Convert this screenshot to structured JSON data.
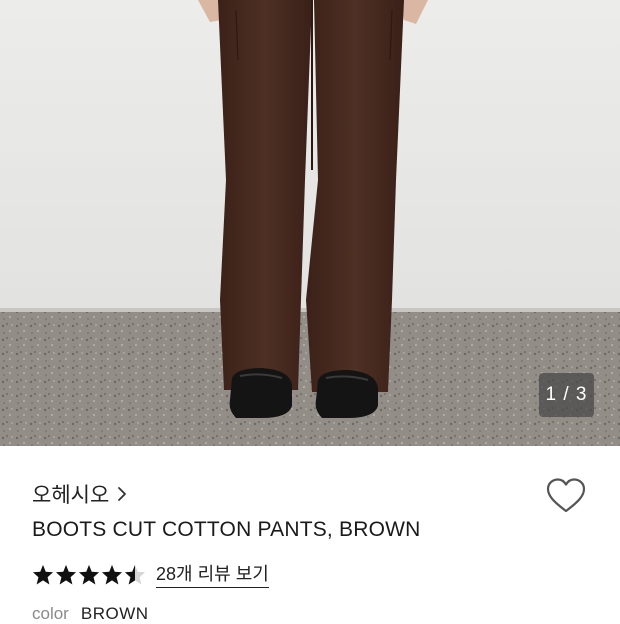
{
  "gallery": {
    "counter": "1 / 3"
  },
  "product": {
    "brand": "오헤시오",
    "title": "BOOTS CUT COTTON PANTS, BROWN",
    "rating": 4.5,
    "review_link": "28개 리뷰 보기",
    "color_label": "color",
    "color_value": "BROWN"
  },
  "icons": {
    "brand_chevron": "chevron-right-icon",
    "wishlist": "heart-outline-icon",
    "rating": "star-icon"
  },
  "colors": {
    "pants": "#452a20",
    "wall": "#e9e9e7",
    "floor": "#8f8a84",
    "star": "#111111"
  }
}
